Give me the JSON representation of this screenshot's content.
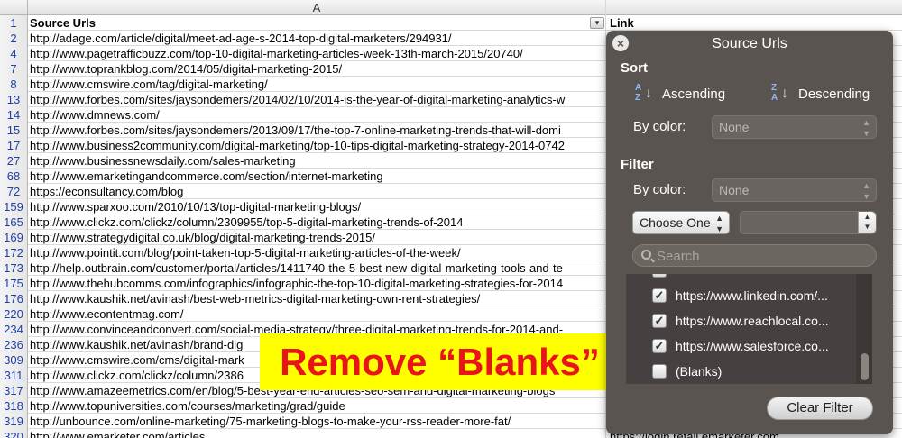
{
  "sheet": {
    "column_header": "A",
    "header_row": {
      "num": "1",
      "colA": "Source Urls",
      "colB": "Link"
    },
    "rows": [
      {
        "num": "2",
        "url": "http://adage.com/article/digital/meet-ad-age-s-2014-top-digital-marketers/294931/",
        "b": ""
      },
      {
        "num": "4",
        "url": "http://www.pagetrafficbuzz.com/top-10-digital-marketing-articles-week-13th-march-2015/20740/",
        "b": ""
      },
      {
        "num": "7",
        "url": "http://www.toprankblog.com/2014/05/digital-marketing-2015/",
        "b": ""
      },
      {
        "num": "8",
        "url": "http://www.cmswire.com/tag/digital-marketing/",
        "b": ""
      },
      {
        "num": "13",
        "url": "http://www.forbes.com/sites/jaysondemers/2014/02/10/2014-is-the-year-of-digital-marketing-analytics-w",
        "b": ""
      },
      {
        "num": "14",
        "url": "http://www.dmnews.com/",
        "b": "98"
      },
      {
        "num": "15",
        "url": "http://www.forbes.com/sites/jaysondemers/2013/09/17/the-top-7-online-marketing-trends-that-will-domi",
        "b": "ua"
      },
      {
        "num": "17",
        "url": "http://www.business2community.com/digital-marketing/top-10-tips-digital-marketing-strategy-2014-0742",
        "b": "ru"
      },
      {
        "num": "27",
        "url": "http://www.businessnewsdaily.com/sales-marketing",
        "b": ""
      },
      {
        "num": "68",
        "url": "http://www.emarketingandcommerce.com/section/internet-marketing",
        "b": "ort"
      },
      {
        "num": "72",
        "url": "https://econsultancy.com/blog",
        "b": ""
      },
      {
        "num": "159",
        "url": "http://www.sparxoo.com/2010/10/13/top-digital-marketing-blogs/",
        "b": ""
      },
      {
        "num": "165",
        "url": "http://www.clickz.com/clickz/column/2309955/top-5-digital-marketing-trends-of-2014",
        "b": ""
      },
      {
        "num": "169",
        "url": "http://www.strategydigital.co.uk/blog/digital-marketing-trends-2015/",
        "b": ""
      },
      {
        "num": "172",
        "url": "http://www.pointit.com/blog/point-taken-top-5-digital-marketing-articles-of-the-week/",
        "b": ""
      },
      {
        "num": "173",
        "url": "http://help.outbrain.com/customer/portal/articles/1411740-the-5-best-new-digital-marketing-tools-and-te",
        "b": "s/1"
      },
      {
        "num": "175",
        "url": "http://www.thehubcomms.com/infographics/infographic-the-top-10-digital-marketing-strategies-for-2014",
        "b": "ks/"
      },
      {
        "num": "176",
        "url": "http://www.kaushik.net/avinash/best-web-metrics-digital-marketing-own-rent-strategies/",
        "b": ""
      },
      {
        "num": "220",
        "url": "http://www.econtentmag.com/",
        "b": ""
      },
      {
        "num": "234",
        "url": "http://www.convinceandconvert.com/social-media-strategy/three-digital-marketing-trends-for-2014-and-",
        "b": ""
      },
      {
        "num": "236",
        "url": "http://www.kaushik.net/avinash/brand-dig",
        "b": ""
      },
      {
        "num": "309",
        "url": "http://www.cmswire.com/cms/digital-mark",
        "b": ""
      },
      {
        "num": "311",
        "url": "http://www.clickz.com/clickz/column/2386",
        "b": ""
      },
      {
        "num": "317",
        "url": "http://www.amazeemetrics.com/en/blog/5-best-year-end-articles-seo-sem-and-digital-marketing-blogs",
        "b": ""
      },
      {
        "num": "318",
        "url": "http://www.topuniversities.com/courses/marketing/grad/guide",
        "b": "nf"
      },
      {
        "num": "319",
        "url": "http://unbounce.com/online-marketing/75-marketing-blogs-to-make-your-rss-reader-more-fat/",
        "b": ""
      },
      {
        "num": "320",
        "url": "http://www.emarketer.com/articles",
        "b": "https://login.retail.emarketer.com"
      }
    ]
  },
  "callout": {
    "text": "Remove “Blanks”"
  },
  "popover": {
    "title": "Source Urls",
    "sort": {
      "heading": "Sort",
      "ascending": "Ascending",
      "descending": "Descending",
      "by_color_label": "By color:",
      "by_color_value": "None"
    },
    "filter": {
      "heading": "Filter",
      "by_color_label": "By color:",
      "by_color_value": "None",
      "condition": "Choose One",
      "search_placeholder": "Search",
      "items": [
        {
          "label": "https://www.linkedin.com/...",
          "checked": true
        },
        {
          "label": "https://www.reachlocal.co...",
          "checked": true
        },
        {
          "label": "https://www.salesforce.co...",
          "checked": true
        },
        {
          "label": "(Blanks)",
          "checked": false
        }
      ],
      "clear_button": "Clear Filter"
    },
    "icons": {
      "close": "close-icon",
      "sort_ascending": "sort-ascending-icon",
      "sort_descending": "sort-descending-icon",
      "search": "search-icon",
      "check": "✓",
      "chevrons": "▲▼"
    },
    "colors": {
      "panel": "#5a5450",
      "list": "#464140",
      "row_number": "#1f3fa8"
    }
  }
}
